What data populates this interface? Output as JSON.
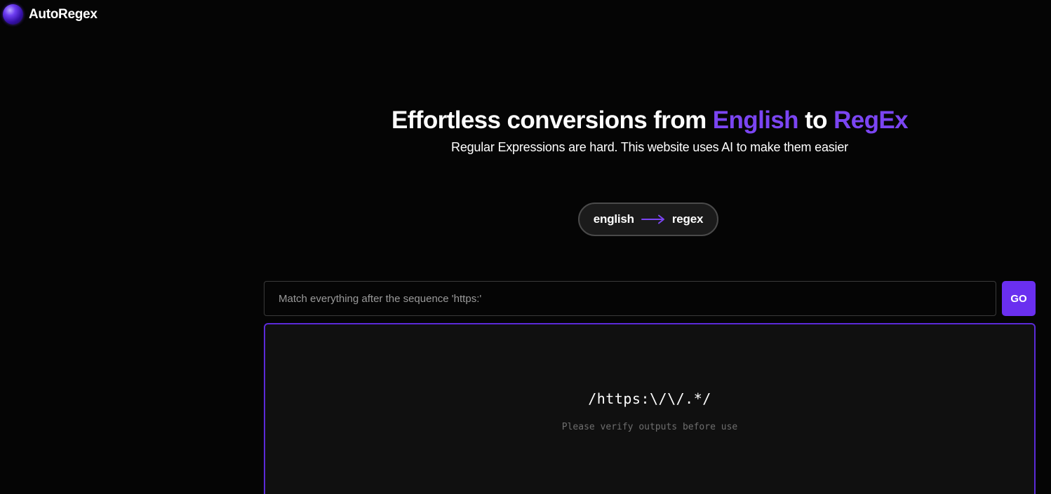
{
  "brand": {
    "name": "AutoRegex",
    "logo_icon": "purple-sphere-logo"
  },
  "hero": {
    "title_part1": "Effortless conversions from ",
    "title_accent1": "English",
    "title_part2": " to ",
    "title_accent2": "RegEx",
    "subtitle": "Regular Expressions are hard. This website uses AI to make them easier"
  },
  "mode_toggle": {
    "from_label": "english",
    "to_label": "regex",
    "arrow_icon": "arrow-right-icon"
  },
  "query": {
    "value": "",
    "placeholder": "Match everything after the sequence 'https:'",
    "go_label": "GO"
  },
  "output": {
    "regex": "/https:\\/\\/.*/",
    "disclaimer": "Please verify outputs before use"
  },
  "colors": {
    "background": "#050505",
    "accent": "#7b45f2",
    "button": "#6a2ff0",
    "panel_border": "#5b2ad8"
  }
}
